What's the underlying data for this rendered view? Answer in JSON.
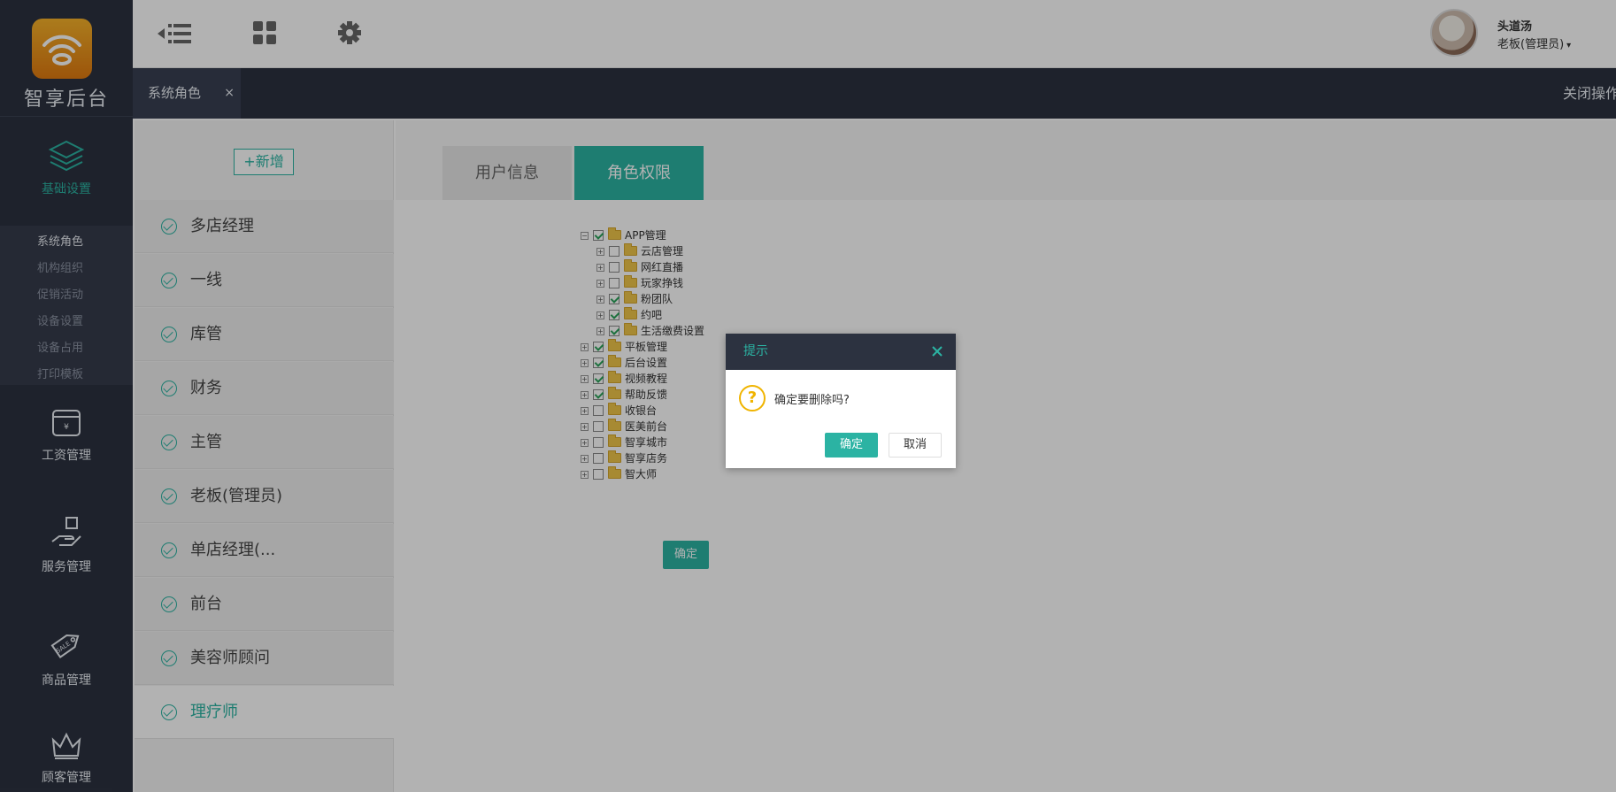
{
  "app": {
    "logo_text": "智享后台"
  },
  "sidebar": {
    "nav": [
      {
        "label": "基础设置",
        "icon": "layers-icon",
        "active": true
      },
      {
        "label": "工资管理",
        "icon": "wallet-icon"
      },
      {
        "label": "服务管理",
        "icon": "hand-service-icon"
      },
      {
        "label": "商品管理",
        "icon": "sale-tag-icon"
      },
      {
        "label": "顾客管理",
        "icon": "crown-icon"
      }
    ],
    "submenu": [
      {
        "label": "系统角色",
        "current": true
      },
      {
        "label": "机构组织"
      },
      {
        "label": "促销活动"
      },
      {
        "label": "设备设置"
      },
      {
        "label": "设备占用"
      },
      {
        "label": "打印模板"
      }
    ]
  },
  "header": {
    "icons": [
      "menu-collapse-icon",
      "grid-icon",
      "gear-icon"
    ],
    "user_name": "头道汤",
    "user_role": "老板(管理员)",
    "caret": "▾"
  },
  "tabs": {
    "open_tab": "系统角色",
    "close_glyph": "×",
    "close_ops": "关闭操作"
  },
  "roles": {
    "add_label": "+新增",
    "items": [
      "多店经理",
      "一线",
      "库管",
      "财务",
      "主管",
      "老板(管理员)",
      "单店经理(...",
      "前台",
      "美容师顾问",
      "理疗师"
    ],
    "selected": "理疗师"
  },
  "content": {
    "tabs": [
      "用户信息",
      "角色权限"
    ],
    "active_tab": "角色权限",
    "tree": [
      {
        "label": "APP管理",
        "checked": true,
        "level": 0,
        "expand": "−"
      },
      {
        "label": "云店管理",
        "checked": false,
        "level": 1,
        "expand": "+"
      },
      {
        "label": "网红直播",
        "checked": false,
        "level": 1,
        "expand": "+"
      },
      {
        "label": "玩家挣钱",
        "checked": false,
        "level": 1,
        "expand": "+"
      },
      {
        "label": "粉团队",
        "checked": true,
        "level": 1,
        "expand": "+"
      },
      {
        "label": "约吧",
        "checked": true,
        "level": 1,
        "expand": "+"
      },
      {
        "label": "生活缴费设置",
        "checked": true,
        "level": 1,
        "expand": "+"
      },
      {
        "label": "平板管理",
        "checked": true,
        "level": 0,
        "expand": "+"
      },
      {
        "label": "后台设置",
        "checked": true,
        "level": 0,
        "expand": "+"
      },
      {
        "label": "视频教程",
        "checked": true,
        "level": 0,
        "expand": "+"
      },
      {
        "label": "帮助反馈",
        "checked": true,
        "level": 0,
        "expand": "+"
      },
      {
        "label": "收银台",
        "checked": false,
        "level": 0,
        "expand": "+"
      },
      {
        "label": "医美前台",
        "checked": false,
        "level": 0,
        "expand": "+"
      },
      {
        "label": "智享城市",
        "checked": false,
        "level": 0,
        "expand": "+"
      },
      {
        "label": "智享店务",
        "checked": false,
        "level": 0,
        "expand": "+"
      },
      {
        "label": "智大师",
        "checked": false,
        "level": 0,
        "expand": "+"
      }
    ],
    "confirm_label": "确定"
  },
  "dialog": {
    "title": "提示",
    "message": "确定要删除吗?",
    "icon_glyph": "?",
    "ok_label": "确定",
    "cancel_label": "取消"
  },
  "colors": {
    "accent": "#2bb3a3",
    "sidebar_bg": "#2c3240",
    "warning": "#f0b400"
  }
}
